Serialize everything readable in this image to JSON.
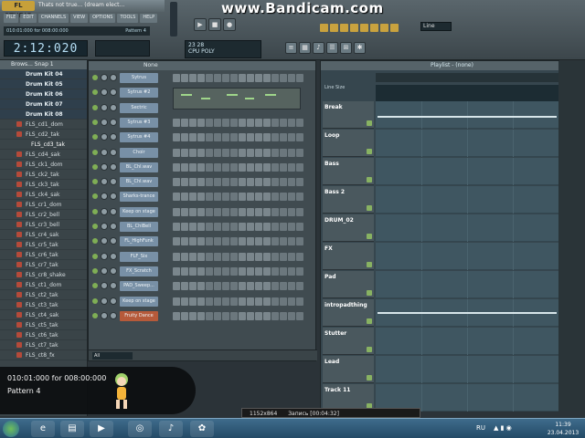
{
  "app": {
    "logo": "FL STUDIO",
    "title": "Thats not true... (dream elect...",
    "watermark": "www.Bandicam.com"
  },
  "menu": [
    "FILE",
    "EDIT",
    "CHANNELS",
    "VIEW",
    "OPTIONS",
    "TOOLS",
    "HELP"
  ],
  "hint": {
    "text": "010:01:000 for 008:00:000",
    "pattern": "Pattern 4"
  },
  "time_display": "2:12:020",
  "cpu_panel": {
    "values": "23   28",
    "labels": "CPU   POLY"
  },
  "snap": "Line",
  "browser": {
    "header": "Brows... Snap 1",
    "items": [
      {
        "label": "Drum Kit 04",
        "kind": "folder"
      },
      {
        "label": "Drum Kit 05",
        "kind": "folder"
      },
      {
        "label": "Drum Kit 06",
        "kind": "folder"
      },
      {
        "label": "Drum Kit 07",
        "kind": "folder"
      },
      {
        "label": "Drum Kit 08",
        "kind": "folder"
      },
      {
        "label": "FLS_cd1_dom",
        "kind": "sample"
      },
      {
        "label": "FLS_cd2_tak",
        "kind": "sample"
      },
      {
        "label": "FLS_cd3_tak",
        "kind": "active"
      },
      {
        "label": "FLS_cd4_sak",
        "kind": "sample"
      },
      {
        "label": "FLS_ck1_dom",
        "kind": "sample"
      },
      {
        "label": "FLS_ck2_tak",
        "kind": "sample"
      },
      {
        "label": "FLS_ck3_tak",
        "kind": "sample"
      },
      {
        "label": "FLS_ck4_sak",
        "kind": "sample"
      },
      {
        "label": "FLS_cr1_dom",
        "kind": "sample"
      },
      {
        "label": "FLS_cr2_bell",
        "kind": "sample"
      },
      {
        "label": "FLS_cr3_bell",
        "kind": "sample"
      },
      {
        "label": "FLS_cr4_sak",
        "kind": "sample"
      },
      {
        "label": "FLS_cr5_tak",
        "kind": "sample"
      },
      {
        "label": "FLS_cr6_tak",
        "kind": "sample"
      },
      {
        "label": "FLS_cr7_tak",
        "kind": "sample"
      },
      {
        "label": "FLS_cr8_shake",
        "kind": "sample"
      },
      {
        "label": "FLS_ct1_dom",
        "kind": "sample"
      },
      {
        "label": "FLS_ct2_tak",
        "kind": "sample"
      },
      {
        "label": "FLS_ct3_tak",
        "kind": "sample"
      },
      {
        "label": "FLS_ct4_sak",
        "kind": "sample"
      },
      {
        "label": "FLS_ct5_tak",
        "kind": "sample"
      },
      {
        "label": "FLS_ct6_tak",
        "kind": "sample"
      },
      {
        "label": "FLS_ct7_tak",
        "kind": "sample"
      },
      {
        "label": "FLS_ct8_fx",
        "kind": "sample"
      }
    ],
    "extra": [
      "FLS_Applause 001",
      "FLS_BadNeedleDr..."
    ]
  },
  "stepseq": {
    "header": "None",
    "channels": [
      "Sytrus",
      "Sytrus #2",
      "Sectric",
      "Sytrus #3",
      "Sytrus #4",
      "Choir",
      "BL_Chl.wav",
      "BL_Chl.wav",
      "Sharks-trance",
      "Keep on stage",
      "BL_ChlBell",
      "FL_HighFunk",
      "FLF_Six",
      "FX_Scratch",
      "PAD_Sweep...",
      "Keep on stage",
      "Fruity Dance"
    ],
    "footer": "All"
  },
  "playlist": {
    "header": "Playlist - (none)",
    "legend": "Line  Size",
    "tracks": [
      "Break",
      "Loop",
      "Bass",
      "Bass 2",
      "DRUM_02",
      "FX",
      "Pad",
      "intropadthing",
      "Stutter",
      "Lead",
      "Track 11"
    ]
  },
  "overlay": {
    "line1": "010:01:000 for 008:00:000",
    "line2": "Pattern 4"
  },
  "bandibar": {
    "resolution": "1152x864",
    "rec": "Запись [00:04:32]"
  },
  "taskbar": {
    "lang": "RU",
    "time": "11:39",
    "date": "23.04.2013"
  },
  "colors": {
    "accent": "#7890a6",
    "highlight": "#b65a3a",
    "note": "#9fd58a",
    "background": "#2b3338"
  }
}
